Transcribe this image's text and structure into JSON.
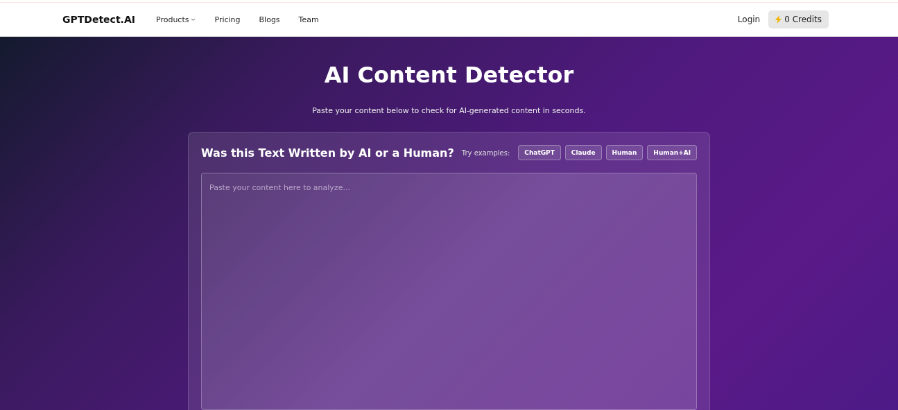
{
  "nav": {
    "brand": "GPTDetect.AI",
    "links": [
      {
        "label": "Products",
        "dropdown": true
      },
      {
        "label": "Pricing",
        "dropdown": false
      },
      {
        "label": "Blogs",
        "dropdown": false
      },
      {
        "label": "Team",
        "dropdown": false
      }
    ],
    "login": "Login",
    "credits": "0 Credits"
  },
  "hero": {
    "title": "AI Content Detector",
    "subtitle": "Paste your content below to check for AI-generated content in seconds."
  },
  "card": {
    "heading": "Was this Text Written by AI or a Human?",
    "examples_label": "Try examples:",
    "examples": [
      "ChatGPT",
      "Claude",
      "Human",
      "Human+AI"
    ],
    "input": {
      "placeholder": "Paste your content here to analyze..."
    }
  }
}
